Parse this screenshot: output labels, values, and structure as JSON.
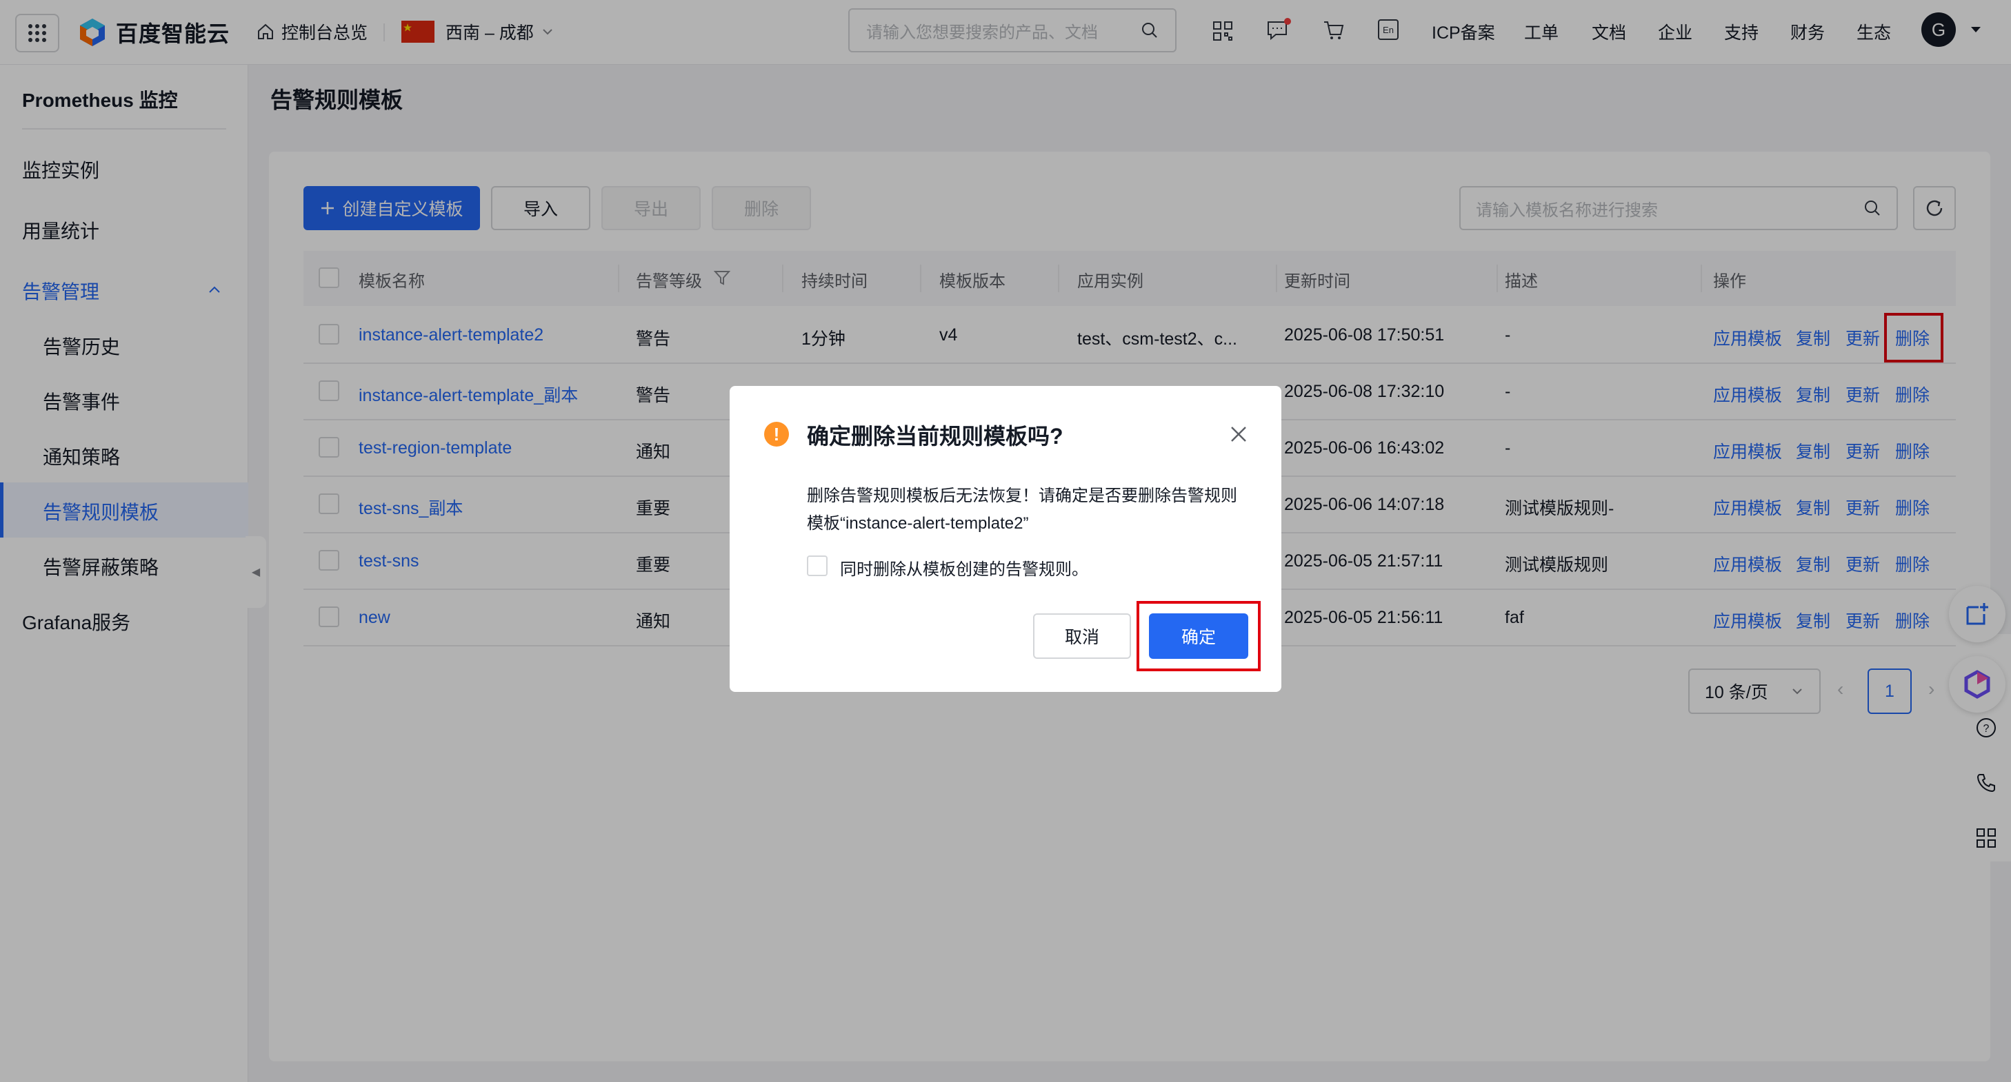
{
  "topbar": {
    "brand": "百度智能云",
    "console_home": "控制台总览",
    "region": "西南 – 成都",
    "search_placeholder": "请输入您想要搜索的产品、文档",
    "nav": [
      "ICP备案",
      "工单",
      "文档",
      "企业",
      "支持",
      "财务",
      "生态"
    ],
    "en_icon_label": "En",
    "avatar_letter": "G"
  },
  "sidebar": {
    "title": "Prometheus 监控",
    "items": {
      "instances": "监控实例",
      "usage": "用量统计",
      "alert_mgmt": "告警管理",
      "alert_history": "告警历史",
      "alert_events": "告警事件",
      "notify_policy": "通知策略",
      "alert_templates": "告警规则模板",
      "alert_silence": "告警屏蔽策略",
      "grafana": "Grafana服务"
    }
  },
  "page": {
    "title": "告警规则模板",
    "toolbar": {
      "create": "创建自定义模板",
      "import": "导入",
      "export": "导出",
      "delete": "删除",
      "search_placeholder": "请输入模板名称进行搜索"
    },
    "table": {
      "columns": [
        "模板名称",
        "告警等级",
        "持续时间",
        "模板版本",
        "应用实例",
        "更新时间",
        "描述",
        "操作"
      ],
      "rows": [
        {
          "name": "instance-alert-template2",
          "level": "警告",
          "duration": "1分钟",
          "version": "v4",
          "instances": "test、csm-test2、c...",
          "updated": "2025-06-08 17:50:51",
          "desc": "-"
        },
        {
          "name": "instance-alert-template_副本",
          "level": "警告",
          "duration": "",
          "version": "",
          "instances": "",
          "updated": "2025-06-08 17:32:10",
          "desc": "-"
        },
        {
          "name": "test-region-template",
          "level": "通知",
          "duration": "",
          "version": "",
          "instances": "",
          "updated": "2025-06-06 16:43:02",
          "desc": "-"
        },
        {
          "name": "test-sns_副本",
          "level": "重要",
          "duration": "",
          "version": "",
          "instances": "",
          "updated": "2025-06-06 14:07:18",
          "desc": "测试模版规则-"
        },
        {
          "name": "test-sns",
          "level": "重要",
          "duration": "",
          "version": "",
          "instances": "",
          "updated": "2025-06-05 21:57:11",
          "desc": "测试模版规则"
        },
        {
          "name": "new",
          "level": "通知",
          "duration": "",
          "version": "",
          "instances": "",
          "updated": "2025-06-05 21:56:11",
          "desc": "faf"
        }
      ],
      "ops": {
        "apply": "应用模板",
        "copy": "复制",
        "update": "更新",
        "delete": "删除"
      }
    },
    "pagination": {
      "page_size": "10 条/页",
      "current": "1"
    }
  },
  "dialog": {
    "title": "确定删除当前规则模板吗?",
    "body_line1": "删除告警规则模板后无法恢复！请确定是否要删除告警规则",
    "body_line2": "模板“instance-alert-template2”",
    "checkbox_label": "同时删除从模板创建的告警规则。",
    "cancel": "取消",
    "confirm": "确定"
  },
  "colors": {
    "primary": "#2468f2",
    "warning": "#ff9326",
    "highlight": "#e0000f"
  }
}
